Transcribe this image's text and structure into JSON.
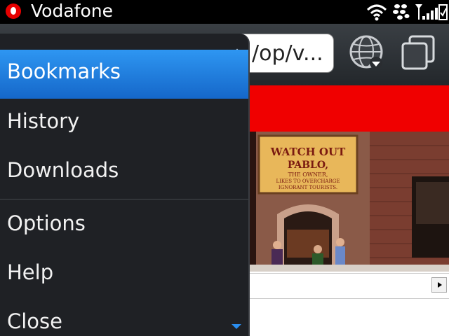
{
  "status_bar": {
    "carrier": "Vodafone"
  },
  "toolbar": {
    "url_text": "/op/v..."
  },
  "menu": {
    "items": [
      {
        "label": "Bookmarks",
        "selected": true
      },
      {
        "label": "History"
      },
      {
        "label": "Downloads"
      },
      {
        "label": "Options"
      },
      {
        "label": "Help"
      },
      {
        "label": "Close"
      }
    ]
  },
  "photo": {
    "sign_line1": "WATCH OUT",
    "sign_line2": "PABLO,",
    "sign_line3": "THE OWNER,",
    "sign_line4": "LIKES TO OVERCHARGE",
    "sign_line5": "IGNORANT TOURISTS."
  },
  "colors": {
    "accent": "#1e7fe0",
    "menu_bg": "#1f2125",
    "banner": "#f00000"
  }
}
